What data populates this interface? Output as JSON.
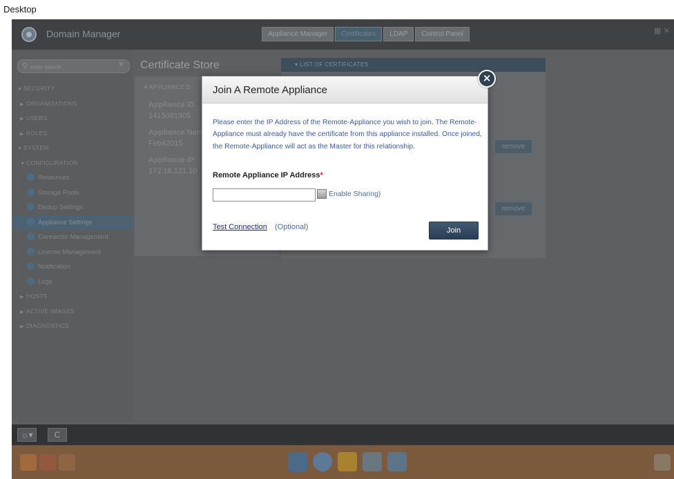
{
  "desktop": {
    "label": "Desktop"
  },
  "app": {
    "title": "Domain Manager",
    "tabs": [
      {
        "label": "Appliance Manager"
      },
      {
        "label": "Certificates"
      },
      {
        "label": "LDAP"
      },
      {
        "label": "Control Panel"
      }
    ]
  },
  "sidebar": {
    "search_placeholder": "enter search",
    "items": [
      {
        "label": "SECURITY",
        "caret": "▼"
      },
      {
        "label": "ORGANIZATIONS",
        "caret": "▶"
      },
      {
        "label": "USERS",
        "caret": "▶"
      },
      {
        "label": "ROLES",
        "caret": "▶"
      },
      {
        "label": "SYSTEM",
        "caret": "▼"
      },
      {
        "label": "CONFIGURATION",
        "caret": "▼"
      },
      {
        "label": "Resources"
      },
      {
        "label": "Storage Pools"
      },
      {
        "label": "Dedup Settings"
      },
      {
        "label": "Appliance Settings"
      },
      {
        "label": "Connector Management"
      },
      {
        "label": "License Management"
      },
      {
        "label": "Notification"
      },
      {
        "label": "Logs"
      },
      {
        "label": "HOSTS",
        "caret": "▶"
      },
      {
        "label": "ACTIVE IMAGES",
        "caret": "▶"
      },
      {
        "label": "DIAGNOSTICS",
        "caret": "▶"
      }
    ]
  },
  "content": {
    "title": "Certificate Store",
    "left_panel": {
      "header": "APPLIANCE D",
      "fields": [
        {
          "label": "Appliance ID",
          "value": "1415081905"
        },
        {
          "label": "Appliance Nam",
          "value": "Feb42015"
        },
        {
          "label": "Appliance IP",
          "value": "172.16.121.10"
        }
      ]
    },
    "certificates": {
      "header": "LIST OF CERTIFICATES",
      "remove_label": "remove"
    }
  },
  "bottom": {
    "settings_label": "☼▾",
    "refresh_label": "C"
  },
  "modal": {
    "title": "Join A Remote Appliance",
    "description": "Please enter the IP Address of the Remote-Appliance you wish to join. The Remote-Appliance must already have the certificate from this appliance installed. Once joined, the Remote-Appliance will act as the Master for this relationship.",
    "ip_label": "Remote Appliance IP Address",
    "required_mark": "*",
    "ip_value": "",
    "enable_sharing_label": "Enable Sharing)",
    "test_connection_label": "Test Connection",
    "optional_label": "(Optional)",
    "join_label": "Join",
    "close_label": "×"
  },
  "colors": {
    "modal_text": "#3b5c9e",
    "join_button": "#2f4660",
    "required": "#d0262b",
    "taskbar": "#7c5a3d"
  }
}
